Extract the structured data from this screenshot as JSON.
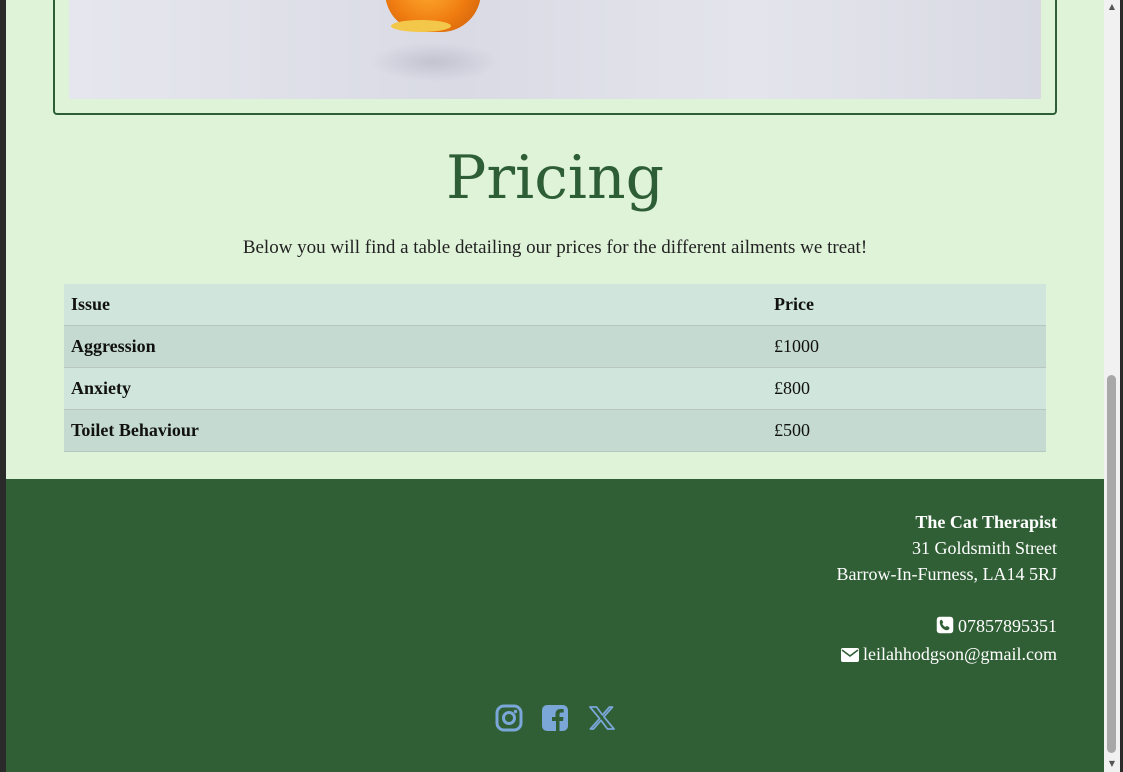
{
  "pricing": {
    "title": "Pricing",
    "description": "Below you will find a table detailing our prices for the different ailments we treat!",
    "headers": {
      "issue": "Issue",
      "price": "Price"
    },
    "rows": [
      {
        "issue": "Aggression",
        "price": "£1000"
      },
      {
        "issue": "Anxiety",
        "price": "£800"
      },
      {
        "issue": "Toilet Behaviour",
        "price": "£500"
      }
    ]
  },
  "footer": {
    "business_name": "The Cat Therapist",
    "address_line1": "31 Goldsmith Street",
    "address_line2": "Barrow-In-Furness, LA14 5RJ",
    "phone": "07857895351",
    "email": "leilahhodgson@gmail.com",
    "social_icons": [
      "instagram-icon",
      "facebook-icon",
      "x-icon"
    ]
  },
  "colors": {
    "page_bg": "#dff3d9",
    "accent": "#2e5e35",
    "footer_bg": "#305f36",
    "social_icon": "#7aa6d8"
  }
}
